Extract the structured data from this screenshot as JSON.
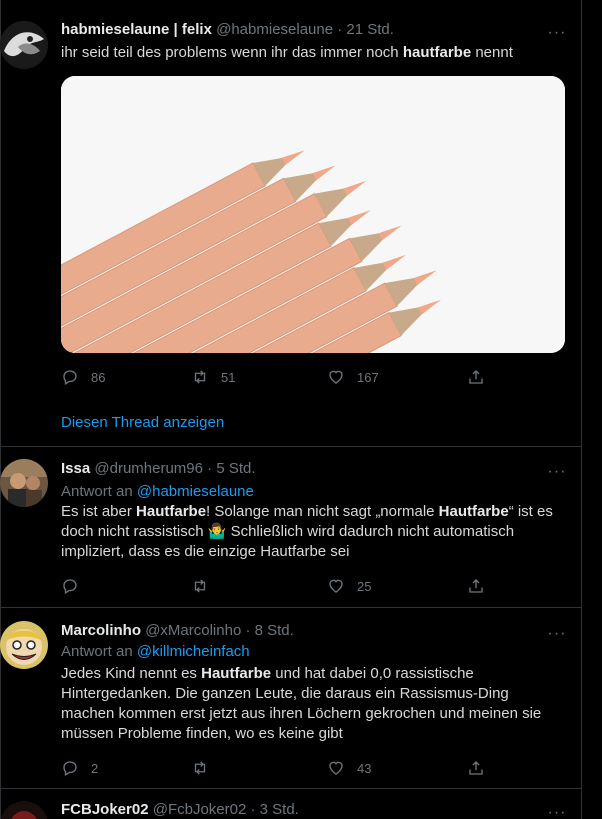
{
  "tweets": [
    {
      "name": "habmieselaune | felix",
      "handle": "@habmieselaune",
      "time": "· 21 Std.",
      "text_plain": "ihr seid teil des problems wenn ihr das immer noch ",
      "text_bold": "hautfarbe",
      "text_tail": " nennt",
      "replies": "86",
      "retweets": "51",
      "likes": "167",
      "thread_link": "Diesen Thread anzeigen"
    },
    {
      "name": "Issa",
      "handle": "@drumherum96",
      "time": "· 5 Std.",
      "reply_prefix": "Antwort an ",
      "reply_to": "@habmieselaune",
      "t1": "Es ist aber ",
      "b1": "Hautfarbe",
      "t2": "! Solange man nicht sagt „normale ",
      "b2": "Hautfarbe",
      "t3": "“ ist es doch nicht rassistisch ",
      "emoji": "🤷‍♂️",
      "t4": " Schließlich wird dadurch nicht automatisch impliziert, dass es die einzige Hautfarbe sei",
      "replies": "",
      "retweets": "",
      "likes": "25"
    },
    {
      "name": "Marcolinho",
      "handle": "@xMarcolinho",
      "time": "· 8 Std.",
      "reply_prefix": "Antwort an ",
      "reply_to": "@killmicheinfach",
      "t1": "Jedes Kind nennt es ",
      "b1": "Hautfarbe",
      "t2": " und hat dabei 0,0 rassistische Hintergedanken. Die ganzen Leute, die daraus ein Rassismus-Ding machen kommen erst jetzt aus ihren Löchern gekrochen und meinen sie müssen Probleme finden, wo es keine gibt",
      "replies": "2",
      "retweets": "",
      "likes": "43"
    },
    {
      "name": "FCBJoker02",
      "handle": "@FcbJoker02",
      "time": "· 3 Std."
    }
  ],
  "more_glyph": "···",
  "colors": {
    "accent": "#1d9bf0",
    "muted": "#6e767d",
    "text": "#d9d9d9",
    "background": "#000000"
  }
}
